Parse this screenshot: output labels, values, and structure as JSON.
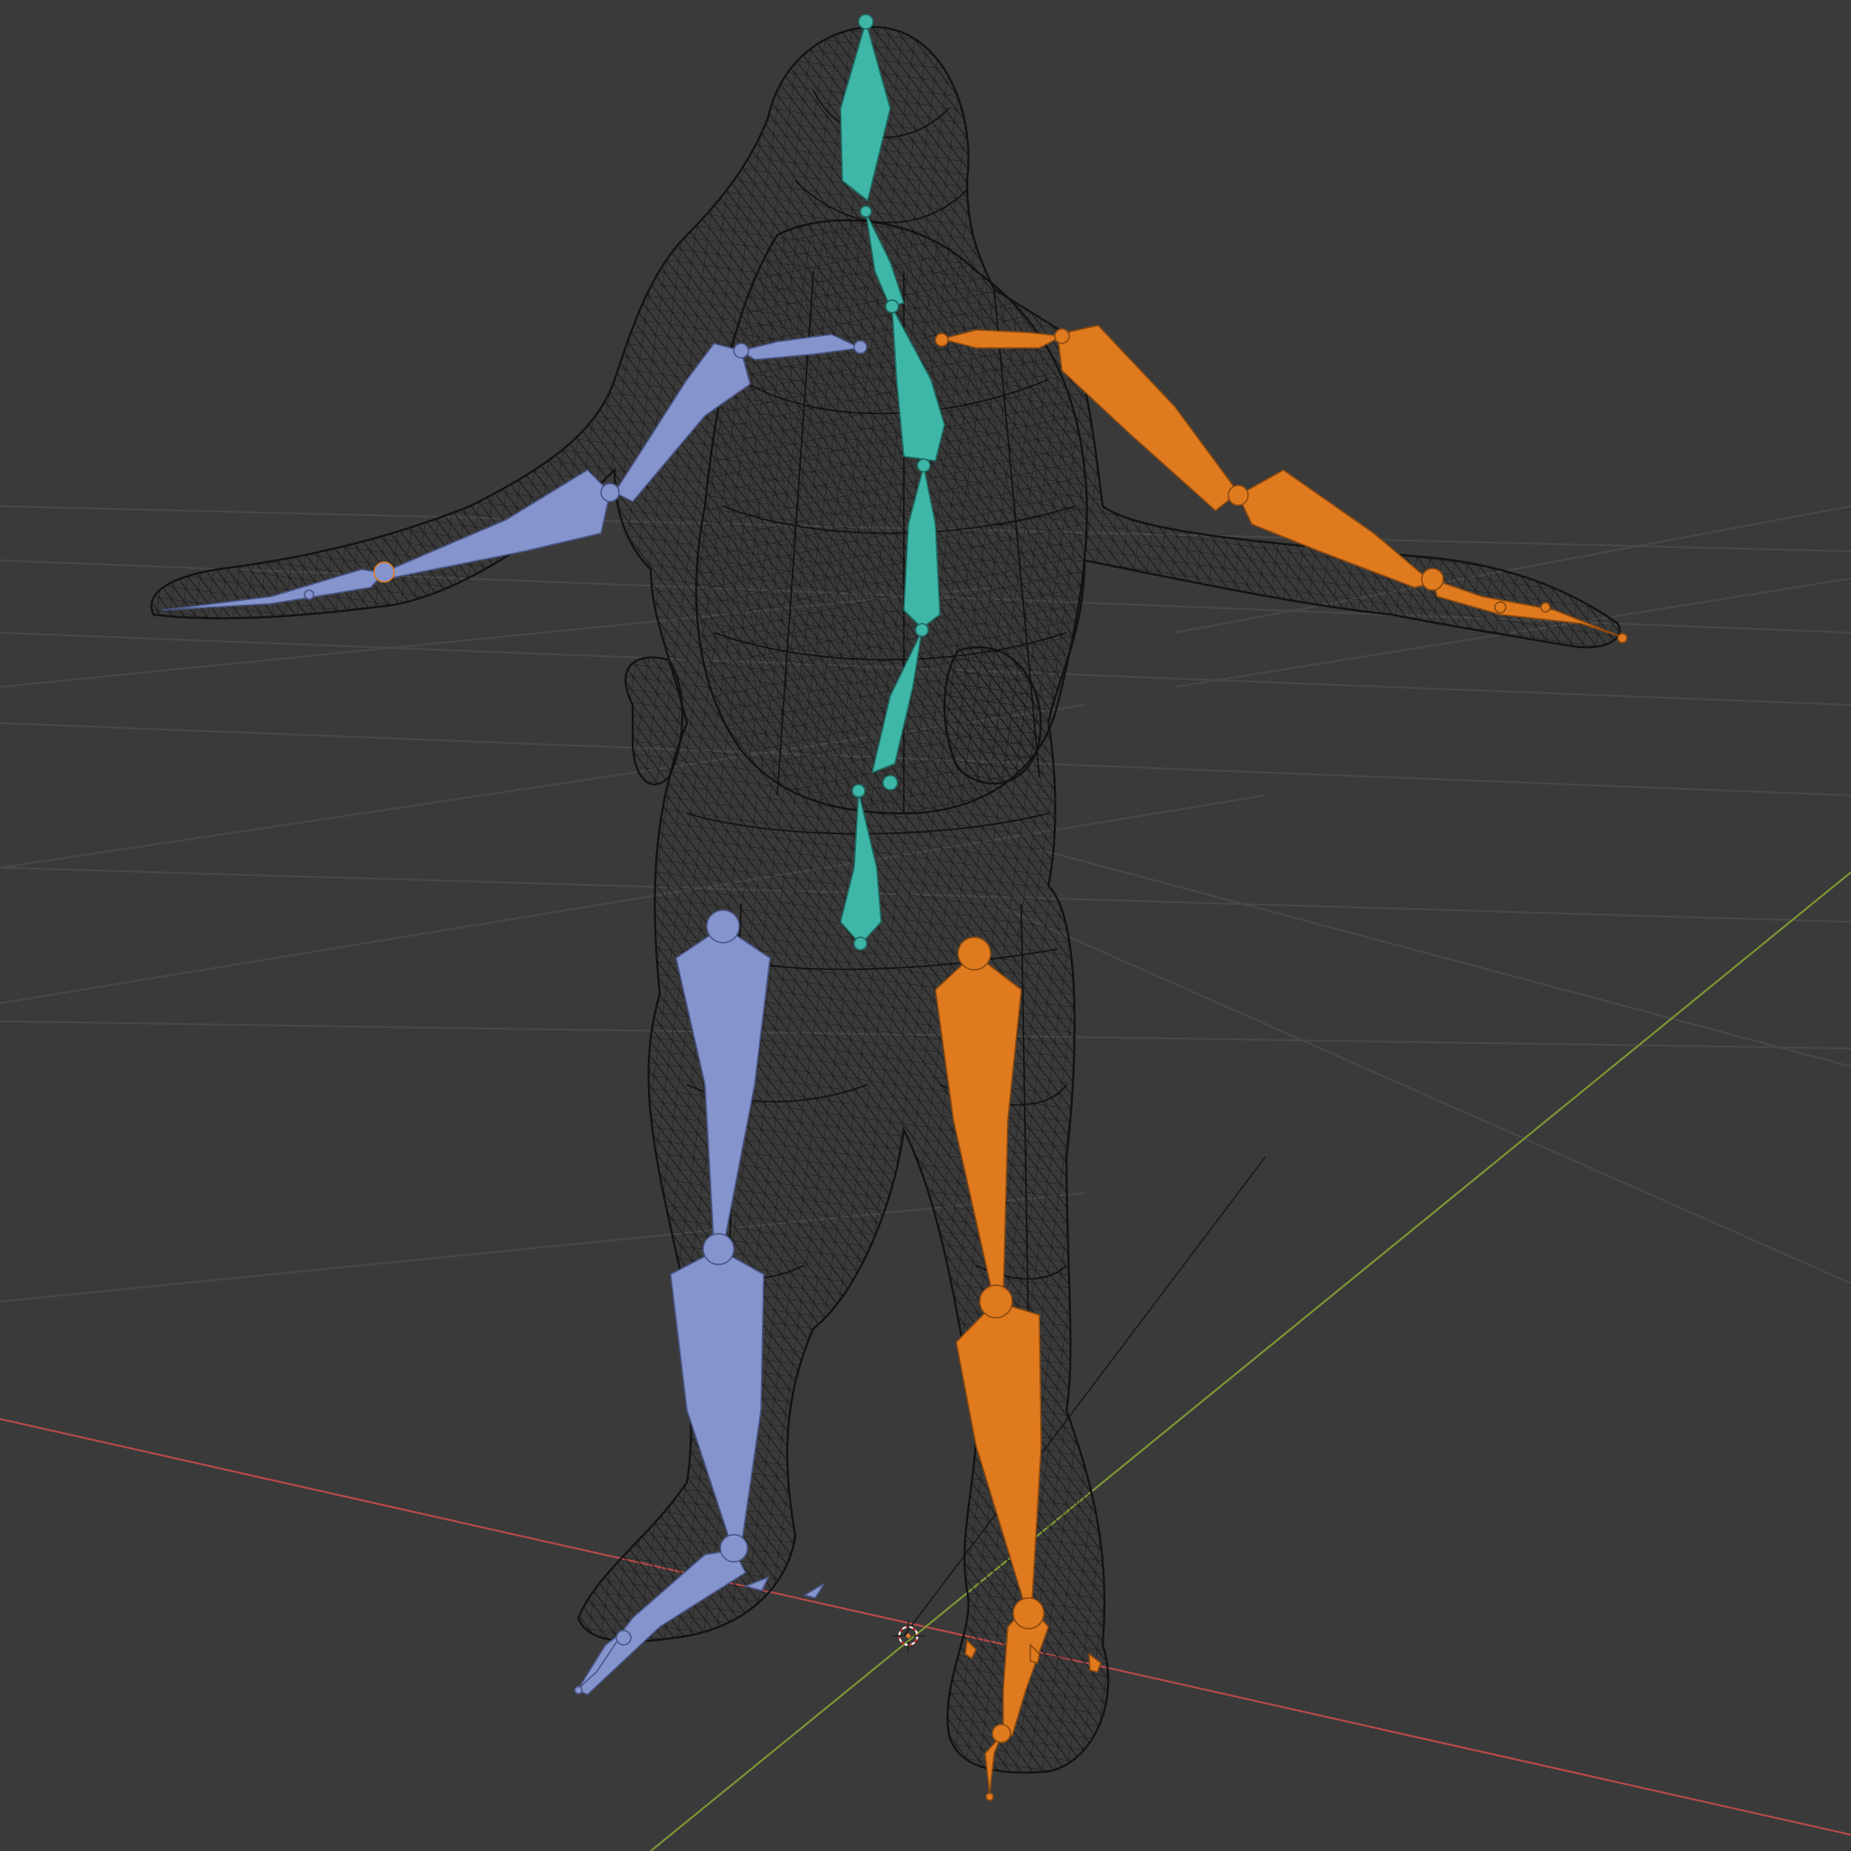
{
  "viewport": {
    "background": "#3a3a3a",
    "grid_color": "#4a4a4a",
    "x_axis_color": "#c94a4a",
    "y_axis_color": "#8aa23a",
    "wireframe_color": "#111111"
  },
  "armature": {
    "center_group_color": "#3fb7a8",
    "left_group_color": "#8594cc",
    "right_group_color": "#e07a1f"
  }
}
